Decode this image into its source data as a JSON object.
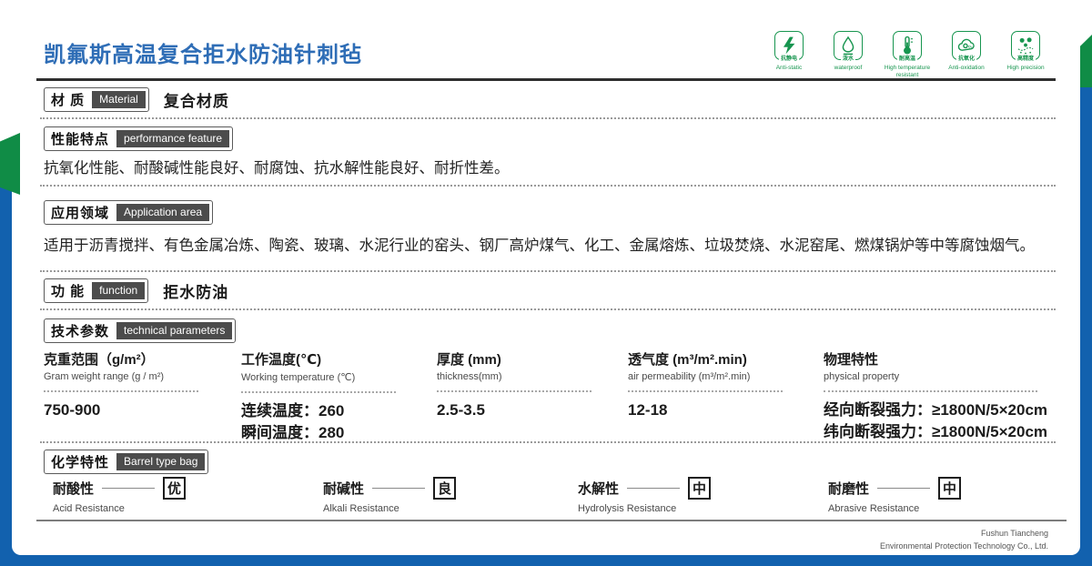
{
  "page": {
    "title": "凯氟斯高温复合拒水防油针刺毡",
    "colors": {
      "accent_blue": "#1261ae",
      "accent_green": "#108c46",
      "title_blue": "#2e6db6",
      "badge_dark": "#4c4c4c"
    }
  },
  "feature_icons": [
    {
      "icon": "anti-static-icon",
      "zh": "抗静电",
      "en": "Anti-static"
    },
    {
      "icon": "waterproof-icon",
      "zh": "泼水",
      "en": "waterproof"
    },
    {
      "icon": "high-temperature-icon",
      "zh": "耐高温",
      "en": "High temperature resistant"
    },
    {
      "icon": "anti-oxidation-icon",
      "zh": "抗氧化",
      "en": "Anti-oxidation"
    },
    {
      "icon": "high-precision-icon",
      "zh": "高精度",
      "en": "High precision"
    }
  ],
  "sections": {
    "material": {
      "zh": "材 质",
      "en": "Material",
      "value": "复合材质"
    },
    "performance": {
      "zh": "性能特点",
      "en": "performance feature",
      "value": "抗氧化性能、耐酸碱性能良好、耐腐蚀、抗水解性能良好、耐折性差。"
    },
    "application": {
      "zh": "应用领域",
      "en": "Application area",
      "value": "适用于沥青搅拌、有色金属冶炼、陶瓷、玻璃、水泥行业的窑头、钢厂高炉煤气、化工、金属熔炼、垃圾焚烧、水泥窑尾、燃煤锅炉等中等腐蚀烟气。"
    },
    "function": {
      "zh": "功 能",
      "en": "function",
      "value": "拒水防油"
    },
    "technical": {
      "zh": "技术参数",
      "en": "technical parameters"
    },
    "chemical": {
      "zh": "化学特性",
      "en": "Barrel type bag"
    }
  },
  "parameters": [
    {
      "zh": "克重范围（g/m²）",
      "en": "Gram weight range (g / m²)",
      "value": "750-900"
    },
    {
      "zh": "工作温度(℃)",
      "en": "Working temperature (℃)",
      "value": "连续温度：260\n瞬间温度：280"
    },
    {
      "zh": "厚度 (mm)",
      "en": "thickness(mm)",
      "value": "2.5-3.5"
    },
    {
      "zh": "透气度 (m³/m².min)",
      "en": "air permeability (m³/m².min)",
      "value": "12-18"
    },
    {
      "zh": "物理特性",
      "en": "physical property",
      "value": "经向断裂强力：≥1800N/5×20cm\n纬向断裂强力：≥1800N/5×20cm"
    }
  ],
  "chemical_properties": [
    {
      "zh": "耐酸性",
      "en": "Acid Resistance",
      "grade": "优"
    },
    {
      "zh": "耐碱性",
      "en": "Alkali Resistance",
      "grade": "良"
    },
    {
      "zh": "水解性",
      "en": "Hydrolysis Resistance",
      "grade": "中"
    },
    {
      "zh": "耐磨性",
      "en": "Abrasive Resistance",
      "grade": "中"
    }
  ],
  "footer": {
    "company_line1": "Fushun Tiancheng",
    "company_line2": "Environmental Protection Technology Co., Ltd."
  }
}
